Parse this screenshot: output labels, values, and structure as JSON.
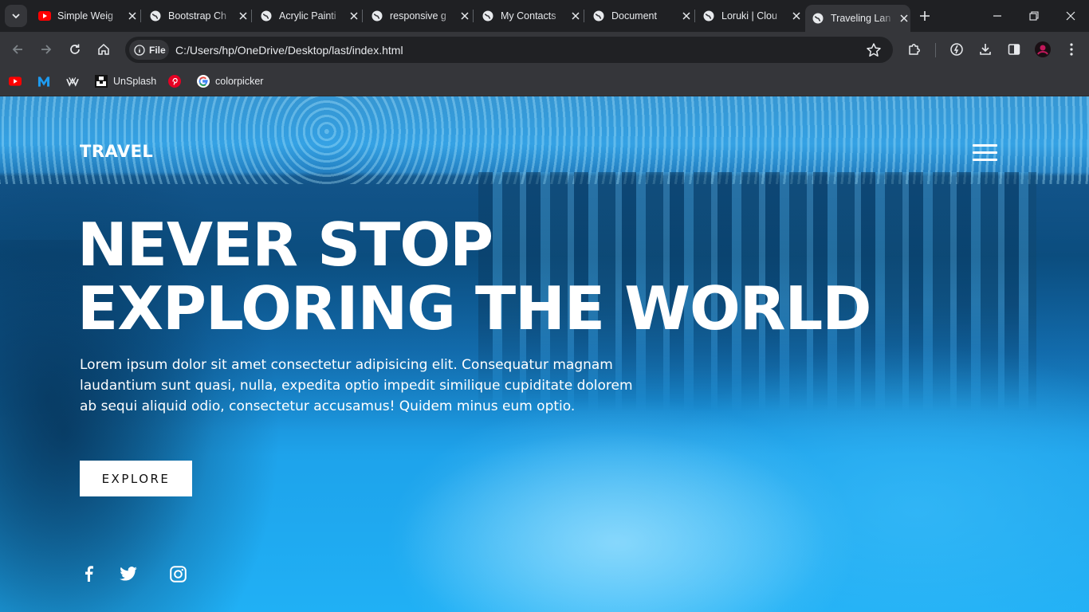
{
  "browser": {
    "tabs": [
      {
        "title": "Simple Weig",
        "icon": "youtube-icon"
      },
      {
        "title": "Bootstrap Ch",
        "icon": "globe-icon"
      },
      {
        "title": "Acrylic Painti",
        "icon": "globe-icon"
      },
      {
        "title": "responsive g",
        "icon": "globe-icon"
      },
      {
        "title": "My Contacts",
        "icon": "globe-icon"
      },
      {
        "title": "Document",
        "icon": "globe-icon"
      },
      {
        "title": "Loruki | Clou",
        "icon": "globe-icon"
      },
      {
        "title": "Traveling Lan",
        "icon": "globe-icon",
        "active": true
      }
    ],
    "address": {
      "scheme_label": "File",
      "url": "C:/Users/hp/OneDrive/Desktop/last/index.html"
    },
    "bookmarks": [
      {
        "label": "",
        "icon": "youtube-icon"
      },
      {
        "label": "",
        "icon": "m-logo-icon"
      },
      {
        "label": "",
        "icon": "wave-logo-icon"
      },
      {
        "label": "UnSplash",
        "icon": "unsplash-icon"
      },
      {
        "label": "",
        "icon": "pinterest-icon"
      },
      {
        "label": "colorpicker",
        "icon": "google-icon"
      }
    ]
  },
  "page": {
    "brand": "TRAVEL",
    "headline_line1": "NEVER STOP",
    "headline_line2": "EXPLORING THE WORLD",
    "description": "Lorem ipsum dolor sit amet consectetur adipisicing elit. Consequatur magnam laudantium sunt quasi, nulla, expedita optio impedit similique cupiditate dolorem ab sequi aliquid odio, consectetur accusamus! Quidem minus eum optio.",
    "cta_label": "EXPLORE",
    "social": [
      "facebook-icon",
      "twitter-icon",
      "instagram-icon"
    ]
  },
  "colors": {
    "chrome_dark": "#1f2023",
    "chrome_toolbar": "#35363a",
    "hero_blue": "#1ea3eb",
    "text_white": "#ffffff"
  }
}
